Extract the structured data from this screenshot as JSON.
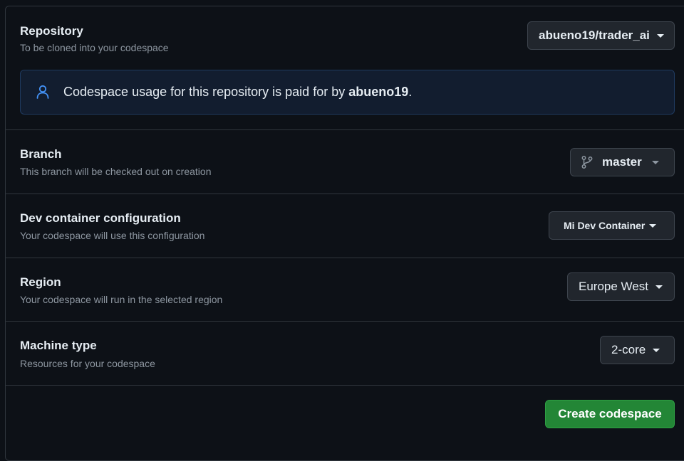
{
  "repository": {
    "title": "Repository",
    "description": "To be cloned into your codespace",
    "selected": "abueno19/trader_ai"
  },
  "notice": {
    "text_prefix": "Codespace usage for this repository is paid for by ",
    "owner": "abueno19",
    "text_suffix": ".",
    "icon": "person-icon"
  },
  "branch": {
    "title": "Branch",
    "description": "This branch will be checked out on creation",
    "selected": "master",
    "icon": "git-branch-icon"
  },
  "devcontainer": {
    "title": "Dev container configuration",
    "description": "Your codespace will use this configuration",
    "selected": "Mi Dev Container"
  },
  "region": {
    "title": "Region",
    "description": "Your codespace will run in the selected region",
    "selected": "Europe West"
  },
  "machine": {
    "title": "Machine type",
    "description": "Resources for your codespace",
    "selected": "2-core"
  },
  "actions": {
    "create_label": "Create codespace"
  },
  "colors": {
    "background": "#0d1117",
    "border": "#30363d",
    "primary_button": "#238636",
    "notice_background": "#121d2f",
    "accent_icon": "#4493f8"
  }
}
